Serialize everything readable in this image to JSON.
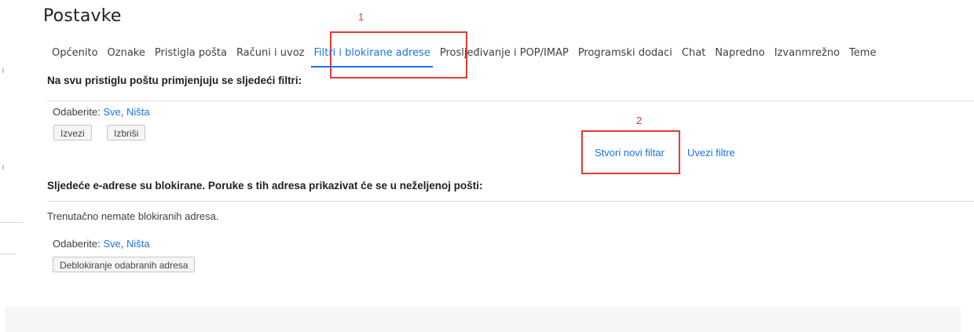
{
  "page_title": "Postavke",
  "tabs": [
    {
      "label": "Općenito",
      "active": false
    },
    {
      "label": "Oznake",
      "active": false
    },
    {
      "label": "Pristigla pošta",
      "active": false
    },
    {
      "label": "Računi i uvoz",
      "active": false
    },
    {
      "label": "Filtri i blokirane adrese",
      "active": true
    },
    {
      "label": "Prosljeđivanje i POP/IMAP",
      "active": false
    },
    {
      "label": "Programski dodaci",
      "active": false
    },
    {
      "label": "Chat",
      "active": false
    },
    {
      "label": "Napredno",
      "active": false
    },
    {
      "label": "Izvanmrežno",
      "active": false
    },
    {
      "label": "Teme",
      "active": false
    }
  ],
  "filters": {
    "title": "Na svu pristiglu poštu primjenjuju se sljedeći filtri:",
    "select_label": "Odaberite:",
    "select_all": "Sve",
    "select_separator": ",",
    "select_none": "Ništa",
    "export_button": "Izvezi",
    "delete_button": "Izbriši",
    "create_filter_link": "Stvori novi filtar",
    "import_filters_link": "Uvezi filtre"
  },
  "blocked": {
    "title": "Sljedeće e-adrese su blokirane. Poruke s tih adresa prikazivat će se u neželjenoj pošti:",
    "empty_message": "Trenutačno nemate blokiranih adresa.",
    "select_label": "Odaberite:",
    "select_all": "Sve",
    "select_separator": ",",
    "select_none": "Ništa",
    "unblock_button": "Deblokiranje odabranih adresa"
  },
  "annotations": {
    "label_1": "1",
    "label_2": "2",
    "color": "#e53935"
  },
  "colors": {
    "accent": "#1a73e8",
    "text": "#202124",
    "divider": "#e0e0e0"
  }
}
